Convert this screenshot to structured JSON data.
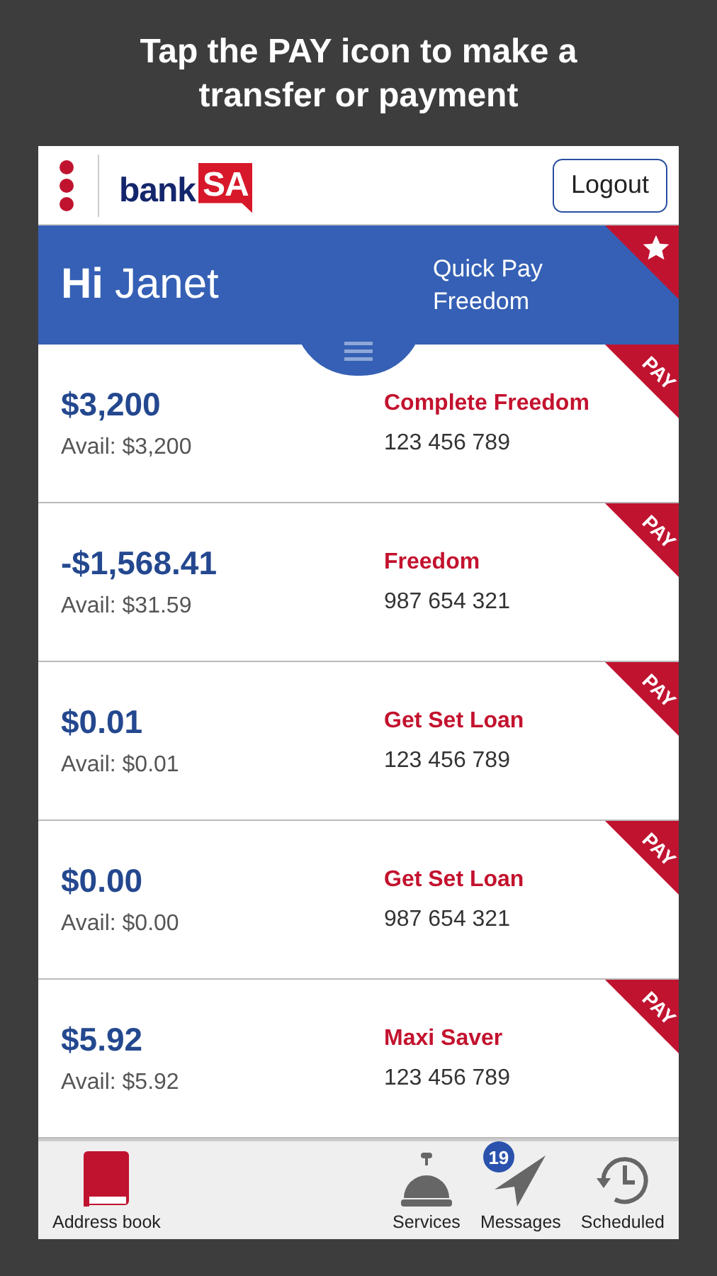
{
  "caption": "Tap the PAY icon to make a transfer or payment",
  "header": {
    "logo": {
      "prefix": "bank",
      "suffix": "SA"
    },
    "logout": "Logout"
  },
  "banner": {
    "greeting": "Hi",
    "name": "Janet",
    "quick_pay_label": "Quick Pay",
    "quick_pay_account": "Freedom"
  },
  "accounts": [
    {
      "balance": "$3,200",
      "available": "Avail: $3,200",
      "name": "Complete Freedom",
      "number": "123 456 789",
      "badge": "PAY"
    },
    {
      "balance": "-$1,568.41",
      "available": "Avail: $31.59",
      "name": "Freedom",
      "number": "987 654 321",
      "badge": "PAY"
    },
    {
      "balance": "$0.01",
      "available": "Avail: $0.01",
      "name": "Get Set Loan",
      "number": "123 456 789",
      "badge": "PAY"
    },
    {
      "balance": "$0.00",
      "available": "Avail: $0.00",
      "name": "Get Set Loan",
      "number": "987 654 321",
      "badge": "PAY"
    },
    {
      "balance": "$5.92",
      "available": "Avail: $5.92",
      "name": "Maxi Saver",
      "number": "123 456 789",
      "badge": "PAY"
    }
  ],
  "nav": [
    {
      "kind": "address",
      "label": "Address book"
    },
    {
      "kind": "services",
      "label": "Services"
    },
    {
      "kind": "messages",
      "label": "Messages",
      "badge": "19"
    },
    {
      "kind": "scheduled",
      "label": "Scheduled"
    }
  ]
}
